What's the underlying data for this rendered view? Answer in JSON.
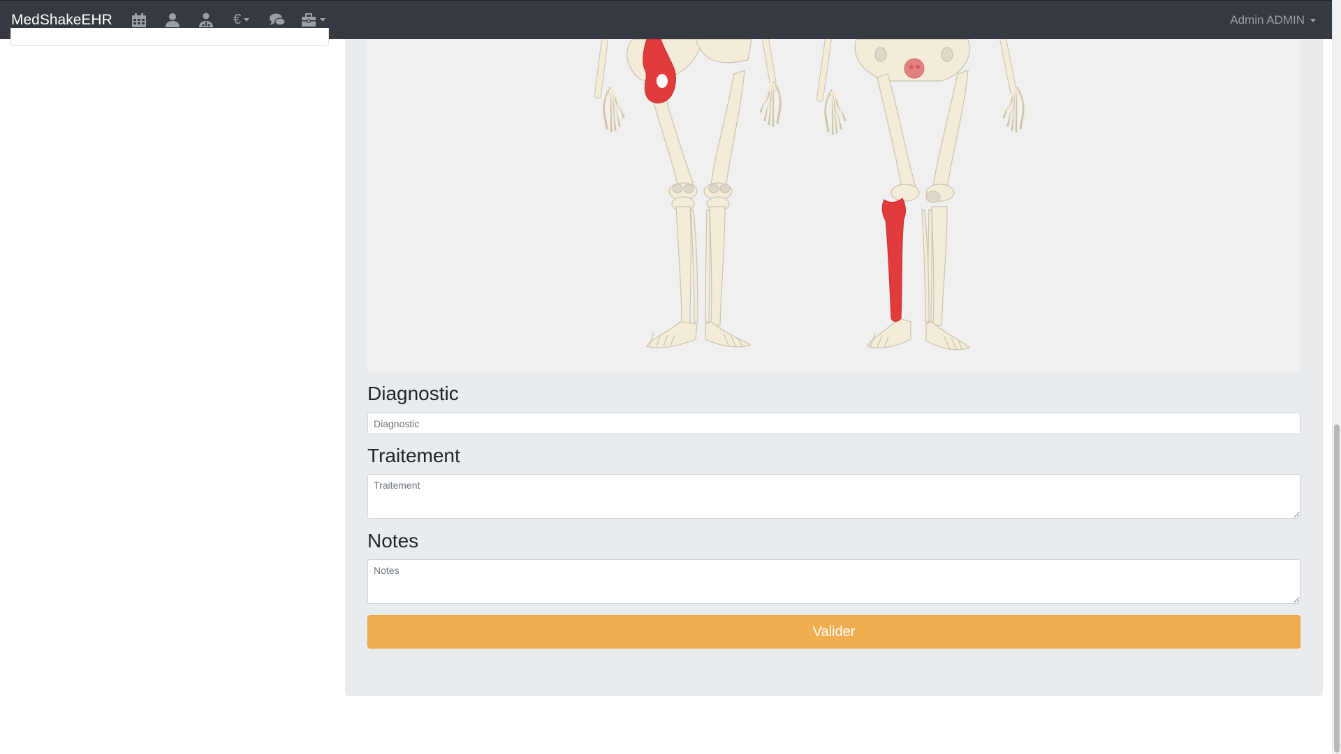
{
  "navbar": {
    "brand": "MedShakeEHR",
    "icons": [
      "calendar-icon",
      "user-icon",
      "doctor-icon",
      "euro-icon",
      "chat-icon",
      "toolbox-icon"
    ],
    "user_label": "Admin ADMIN"
  },
  "form": {
    "diagnostic_title": "Diagnostic",
    "diagnostic_placeholder": "Diagnostic",
    "traitement_title": "Traitement",
    "traitement_placeholder": "Traitement",
    "notes_title": "Notes",
    "notes_placeholder": "Notes",
    "submit_label": "Valider"
  },
  "colors": {
    "navbar": "#343a40",
    "panel": "#e9ecef",
    "highlight_bone": "#e23b3b",
    "submit": "#f0ad4e"
  }
}
